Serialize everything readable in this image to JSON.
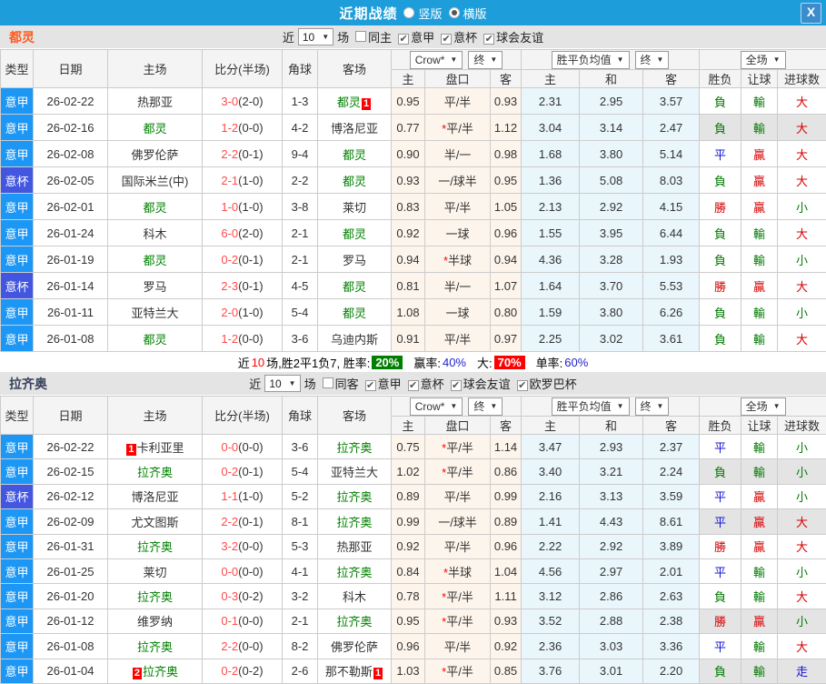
{
  "titlebar": {
    "title": "近期战绩",
    "vertical_label": "竖版",
    "horizontal_label": "横版",
    "close": "X"
  },
  "colors": {
    "topbar": "#1d9dd9",
    "league_badge": "#1d97f5",
    "cup_badge": "#4356e0",
    "team_green": "#008000",
    "score_red": "#ff4a4a",
    "win_red": "#d60000",
    "lose_green": "#007a00",
    "draw_blue": "#1414d6",
    "odds_bg": "#fdf5ec",
    "avg_bg": "#e9f6fc",
    "highlight": "#e4e4e4",
    "rate_green_bg": "#008000",
    "rate_red_bg": "#ff0000",
    "rate_blue_text": "#2222cc"
  },
  "table_header": {
    "cols": [
      "类型",
      "日期",
      "主场",
      "比分(半场)",
      "角球",
      "客场"
    ],
    "sub": [
      "主",
      "盘口",
      "客",
      "主",
      "和",
      "客",
      "胜负",
      "让球",
      "进球数"
    ],
    "odds_select": "Crow*",
    "final_select": "终",
    "avg_select": "胜平负均值",
    "full_select": "全场"
  },
  "sections": [
    {
      "team": "都灵",
      "team_color": "#ff5a1e",
      "filter": {
        "near": "近",
        "count": "10",
        "games": "场",
        "checkboxes": [
          {
            "label": "同主",
            "checked": false
          },
          {
            "label": "意甲",
            "checked": true
          },
          {
            "label": "意杯",
            "checked": true
          },
          {
            "label": "球会友谊",
            "checked": true
          }
        ]
      },
      "rows": [
        {
          "type": "意甲",
          "date": "26-02-22",
          "home": "热那亚",
          "home_green": false,
          "home_badge": "",
          "score": "3-0",
          "half": "(2-0)",
          "corner": "1-3",
          "away": "都灵",
          "away_green": true,
          "away_badge": "1",
          "odds_home": "0.95",
          "handicap": "平/半",
          "handicap_star": false,
          "odds_away": "0.93",
          "avg_home": "2.31",
          "avg_draw": "2.95",
          "avg_away": "3.57",
          "result": "負",
          "handicap_result": "輸",
          "goals": "大",
          "highlight": false
        },
        {
          "type": "意甲",
          "date": "26-02-16",
          "home": "都灵",
          "home_green": true,
          "home_badge": "",
          "score": "1-2",
          "half": "(0-0)",
          "corner": "4-2",
          "away": "博洛尼亚",
          "away_green": false,
          "away_badge": "",
          "odds_home": "0.77",
          "handicap": "平/半",
          "handicap_star": true,
          "odds_away": "1.12",
          "avg_home": "3.04",
          "avg_draw": "3.14",
          "avg_away": "2.47",
          "result": "負",
          "handicap_result": "輸",
          "goals": "大",
          "highlight": true
        },
        {
          "type": "意甲",
          "date": "26-02-08",
          "home": "佛罗伦萨",
          "home_green": false,
          "home_badge": "",
          "score": "2-2",
          "half": "(0-1)",
          "corner": "9-4",
          "away": "都灵",
          "away_green": true,
          "away_badge": "",
          "odds_home": "0.90",
          "handicap": "半/一",
          "handicap_star": false,
          "odds_away": "0.98",
          "avg_home": "1.68",
          "avg_draw": "3.80",
          "avg_away": "5.14",
          "result": "平",
          "handicap_result": "贏",
          "goals": "大",
          "highlight": false
        },
        {
          "type": "意杯",
          "date": "26-02-05",
          "home": "国际米兰(中)",
          "home_green": false,
          "home_badge": "",
          "score": "2-1",
          "half": "(1-0)",
          "corner": "2-2",
          "away": "都灵",
          "away_green": true,
          "away_badge": "",
          "odds_home": "0.93",
          "handicap": "一/球半",
          "handicap_star": false,
          "odds_away": "0.95",
          "avg_home": "1.36",
          "avg_draw": "5.08",
          "avg_away": "8.03",
          "result": "負",
          "handicap_result": "贏",
          "goals": "大",
          "highlight": false
        },
        {
          "type": "意甲",
          "date": "26-02-01",
          "home": "都灵",
          "home_green": true,
          "home_badge": "",
          "score": "1-0",
          "half": "(1-0)",
          "corner": "3-8",
          "away": "莱切",
          "away_green": false,
          "away_badge": "",
          "odds_home": "0.83",
          "handicap": "平/半",
          "handicap_star": false,
          "odds_away": "1.05",
          "avg_home": "2.13",
          "avg_draw": "2.92",
          "avg_away": "4.15",
          "result": "勝",
          "handicap_result": "贏",
          "goals": "小",
          "highlight": false
        },
        {
          "type": "意甲",
          "date": "26-01-24",
          "home": "科木",
          "home_green": false,
          "home_badge": "",
          "score": "6-0",
          "half": "(2-0)",
          "corner": "2-1",
          "away": "都灵",
          "away_green": true,
          "away_badge": "",
          "odds_home": "0.92",
          "handicap": "一球",
          "handicap_star": false,
          "odds_away": "0.96",
          "avg_home": "1.55",
          "avg_draw": "3.95",
          "avg_away": "6.44",
          "result": "負",
          "handicap_result": "輸",
          "goals": "大",
          "highlight": false
        },
        {
          "type": "意甲",
          "date": "26-01-19",
          "home": "都灵",
          "home_green": true,
          "home_badge": "",
          "score": "0-2",
          "half": "(0-1)",
          "corner": "2-1",
          "away": "罗马",
          "away_green": false,
          "away_badge": "",
          "odds_home": "0.94",
          "handicap": "半球",
          "handicap_star": true,
          "odds_away": "0.94",
          "avg_home": "4.36",
          "avg_draw": "3.28",
          "avg_away": "1.93",
          "result": "負",
          "handicap_result": "輸",
          "goals": "小",
          "highlight": false
        },
        {
          "type": "意杯",
          "date": "26-01-14",
          "home": "罗马",
          "home_green": false,
          "home_badge": "",
          "score": "2-3",
          "half": "(0-1)",
          "corner": "4-5",
          "away": "都灵",
          "away_green": true,
          "away_badge": "",
          "odds_home": "0.81",
          "handicap": "半/一",
          "handicap_star": false,
          "odds_away": "1.07",
          "avg_home": "1.64",
          "avg_draw": "3.70",
          "avg_away": "5.53",
          "result": "勝",
          "handicap_result": "贏",
          "goals": "大",
          "highlight": false
        },
        {
          "type": "意甲",
          "date": "26-01-11",
          "home": "亚特兰大",
          "home_green": false,
          "home_badge": "",
          "score": "2-0",
          "half": "(1-0)",
          "corner": "5-4",
          "away": "都灵",
          "away_green": true,
          "away_badge": "",
          "odds_home": "1.08",
          "handicap": "一球",
          "handicap_star": false,
          "odds_away": "0.80",
          "avg_home": "1.59",
          "avg_draw": "3.80",
          "avg_away": "6.26",
          "result": "負",
          "handicap_result": "輸",
          "goals": "小",
          "highlight": false
        },
        {
          "type": "意甲",
          "date": "26-01-08",
          "home": "都灵",
          "home_green": true,
          "home_badge": "",
          "score": "1-2",
          "half": "(0-0)",
          "corner": "3-6",
          "away": "乌迪内斯",
          "away_green": false,
          "away_badge": "",
          "odds_home": "0.91",
          "handicap": "平/半",
          "handicap_star": false,
          "odds_away": "0.97",
          "avg_home": "2.25",
          "avg_draw": "3.02",
          "avg_away": "3.61",
          "result": "負",
          "handicap_result": "輸",
          "goals": "大",
          "highlight": false
        }
      ],
      "summary": {
        "prefix": "近",
        "count": "10",
        "text": "场,胜2平1负7, 胜率:",
        "win_rate": "20%",
        "draw_label": "赢率:",
        "draw_rate": "40%",
        "big_label": "大:",
        "big_rate": "70%",
        "single_label": "单率:",
        "single_rate": "60%"
      }
    },
    {
      "team": "拉齐奥",
      "team_color": "#39435c",
      "filter": {
        "near": "近",
        "count": "10",
        "games": "场",
        "checkboxes": [
          {
            "label": "同客",
            "checked": false
          },
          {
            "label": "意甲",
            "checked": true
          },
          {
            "label": "意杯",
            "checked": true
          },
          {
            "label": "球会友谊",
            "checked": true
          },
          {
            "label": "欧罗巴杯",
            "checked": true
          }
        ]
      },
      "rows": [
        {
          "type": "意甲",
          "date": "26-02-22",
          "home": "卡利亚里",
          "home_green": false,
          "home_badge": "1",
          "score": "0-0",
          "half": "(0-0)",
          "corner": "3-6",
          "away": "拉齐奥",
          "away_green": true,
          "away_badge": "",
          "odds_home": "0.75",
          "handicap": "平/半",
          "handicap_star": true,
          "odds_away": "1.14",
          "avg_home": "3.47",
          "avg_draw": "2.93",
          "avg_away": "2.37",
          "result": "平",
          "handicap_result": "輸",
          "goals": "小",
          "highlight": false
        },
        {
          "type": "意甲",
          "date": "26-02-15",
          "home": "拉齐奥",
          "home_green": true,
          "home_badge": "",
          "score": "0-2",
          "half": "(0-1)",
          "corner": "5-4",
          "away": "亚特兰大",
          "away_green": false,
          "away_badge": "",
          "odds_home": "1.02",
          "handicap": "平/半",
          "handicap_star": true,
          "odds_away": "0.86",
          "avg_home": "3.40",
          "avg_draw": "3.21",
          "avg_away": "2.24",
          "result": "負",
          "handicap_result": "輸",
          "goals": "小",
          "highlight": true
        },
        {
          "type": "意杯",
          "date": "26-02-12",
          "home": "博洛尼亚",
          "home_green": false,
          "home_badge": "",
          "score": "1-1",
          "half": "(1-0)",
          "corner": "5-2",
          "away": "拉齐奥",
          "away_green": true,
          "away_badge": "",
          "odds_home": "0.89",
          "handicap": "平/半",
          "handicap_star": false,
          "odds_away": "0.99",
          "avg_home": "2.16",
          "avg_draw": "3.13",
          "avg_away": "3.59",
          "result": "平",
          "handicap_result": "贏",
          "goals": "小",
          "highlight": false
        },
        {
          "type": "意甲",
          "date": "26-02-09",
          "home": "尤文图斯",
          "home_green": false,
          "home_badge": "",
          "score": "2-2",
          "half": "(0-1)",
          "corner": "8-1",
          "away": "拉齐奥",
          "away_green": true,
          "away_badge": "",
          "odds_home": "0.99",
          "handicap": "一/球半",
          "handicap_star": false,
          "odds_away": "0.89",
          "avg_home": "1.41",
          "avg_draw": "4.43",
          "avg_away": "8.61",
          "result": "平",
          "handicap_result": "贏",
          "goals": "大",
          "highlight": true
        },
        {
          "type": "意甲",
          "date": "26-01-31",
          "home": "拉齐奥",
          "home_green": true,
          "home_badge": "",
          "score": "3-2",
          "half": "(0-0)",
          "corner": "5-3",
          "away": "热那亚",
          "away_green": false,
          "away_badge": "",
          "odds_home": "0.92",
          "handicap": "平/半",
          "handicap_star": false,
          "odds_away": "0.96",
          "avg_home": "2.22",
          "avg_draw": "2.92",
          "avg_away": "3.89",
          "result": "勝",
          "handicap_result": "贏",
          "goals": "大",
          "highlight": false
        },
        {
          "type": "意甲",
          "date": "26-01-25",
          "home": "莱切",
          "home_green": false,
          "home_badge": "",
          "score": "0-0",
          "half": "(0-0)",
          "corner": "4-1",
          "away": "拉齐奥",
          "away_green": true,
          "away_badge": "",
          "odds_home": "0.84",
          "handicap": "半球",
          "handicap_star": true,
          "odds_away": "1.04",
          "avg_home": "4.56",
          "avg_draw": "2.97",
          "avg_away": "2.01",
          "result": "平",
          "handicap_result": "輸",
          "goals": "小",
          "highlight": false
        },
        {
          "type": "意甲",
          "date": "26-01-20",
          "home": "拉齐奥",
          "home_green": true,
          "home_badge": "",
          "score": "0-3",
          "half": "(0-2)",
          "corner": "3-2",
          "away": "科木",
          "away_green": false,
          "away_badge": "",
          "odds_home": "0.78",
          "handicap": "平/半",
          "handicap_star": true,
          "odds_away": "1.11",
          "avg_home": "3.12",
          "avg_draw": "2.86",
          "avg_away": "2.63",
          "result": "負",
          "handicap_result": "輸",
          "goals": "大",
          "highlight": false
        },
        {
          "type": "意甲",
          "date": "26-01-12",
          "home": "维罗纳",
          "home_green": false,
          "home_badge": "",
          "score": "0-1",
          "half": "(0-0)",
          "corner": "2-1",
          "away": "拉齐奥",
          "away_green": true,
          "away_badge": "",
          "odds_home": "0.95",
          "handicap": "平/半",
          "handicap_star": true,
          "odds_away": "0.93",
          "avg_home": "3.52",
          "avg_draw": "2.88",
          "avg_away": "2.38",
          "result": "勝",
          "handicap_result": "贏",
          "goals": "小",
          "highlight": true
        },
        {
          "type": "意甲",
          "date": "26-01-08",
          "home": "拉齐奥",
          "home_green": true,
          "home_badge": "",
          "score": "2-2",
          "half": "(0-0)",
          "corner": "8-2",
          "away": "佛罗伦萨",
          "away_green": false,
          "away_badge": "",
          "odds_home": "0.96",
          "handicap": "平/半",
          "handicap_star": false,
          "odds_away": "0.92",
          "avg_home": "2.36",
          "avg_draw": "3.03",
          "avg_away": "3.36",
          "result": "平",
          "handicap_result": "輸",
          "goals": "大",
          "highlight": false
        },
        {
          "type": "意甲",
          "date": "26-01-04",
          "home": "拉齐奥",
          "home_green": true,
          "home_badge": "2",
          "score": "0-2",
          "half": "(0-2)",
          "corner": "2-6",
          "away": "那不勒斯",
          "away_green": false,
          "away_badge": "1",
          "odds_home": "1.03",
          "handicap": "平/半",
          "handicap_star": true,
          "odds_away": "0.85",
          "avg_home": "3.76",
          "avg_draw": "3.01",
          "avg_away": "2.20",
          "result": "負",
          "handicap_result": "輸",
          "goals": "走",
          "highlight": true
        }
      ]
    }
  ]
}
